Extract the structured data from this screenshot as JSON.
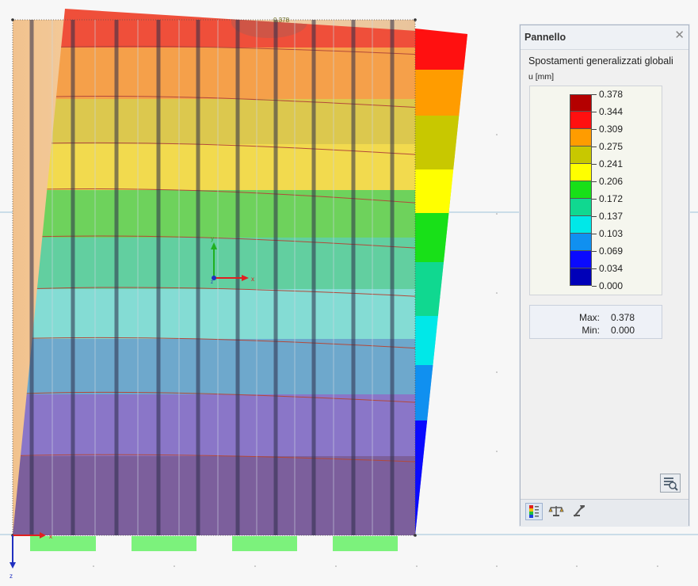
{
  "viewport": {
    "top_label": "0.378",
    "axes": {
      "x": "x",
      "y": "y",
      "z": "z"
    },
    "global_axes": {
      "x": "x",
      "z": "z"
    }
  },
  "panel": {
    "title": "Pannello",
    "close_glyph": "✕",
    "subtitle": "Spostamenti generalizzati globali",
    "unit": "u [mm]",
    "legend": {
      "values": [
        "0.378",
        "0.344",
        "0.309",
        "0.275",
        "0.241",
        "0.206",
        "0.172",
        "0.137",
        "0.103",
        "0.069",
        "0.034",
        "0.000"
      ],
      "colors": [
        "#b40000",
        "#ff1010",
        "#ff9c00",
        "#c8c800",
        "#ffff00",
        "#18e018",
        "#10d890",
        "#00e8e8",
        "#1090f0",
        "#0a0aff",
        "#0000b8"
      ]
    },
    "max_label": "Max:",
    "max_value": "0.378",
    "min_label": "Min:",
    "min_value": "0.000",
    "icons": {
      "settings": "settings-icon",
      "tab_legend": "color-scale-icon",
      "tab_balance": "balance-icon",
      "tab_tools": "tools-icon"
    }
  }
}
